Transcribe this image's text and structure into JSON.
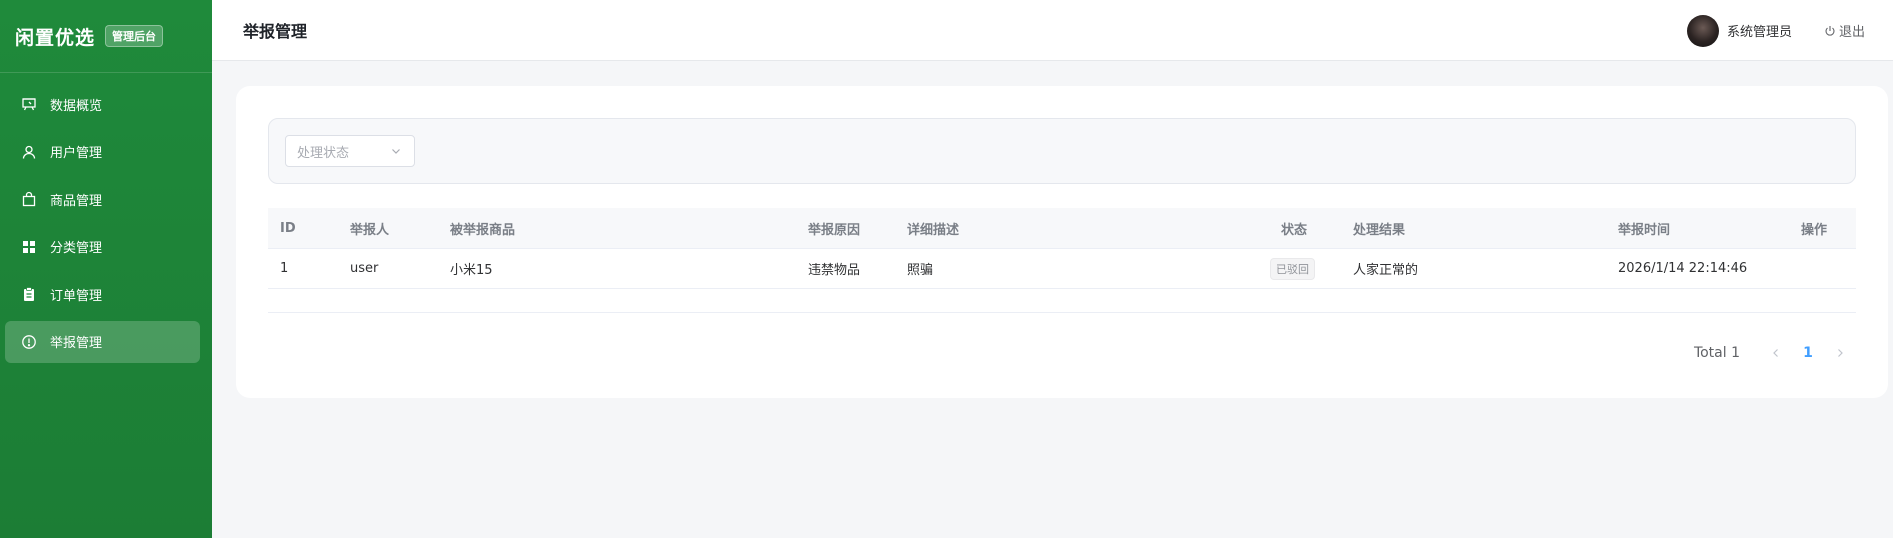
{
  "brand": {
    "title": "闲置优选",
    "badge": "管理后台"
  },
  "sidebar": {
    "items": [
      {
        "label": "数据概览",
        "icon": "dashboard-icon",
        "active": false
      },
      {
        "label": "用户管理",
        "icon": "user-icon",
        "active": false
      },
      {
        "label": "商品管理",
        "icon": "shopping-bag-icon",
        "active": false
      },
      {
        "label": "分类管理",
        "icon": "grid-icon",
        "active": false
      },
      {
        "label": "订单管理",
        "icon": "clipboard-icon",
        "active": false
      },
      {
        "label": "举报管理",
        "icon": "warning-circle-icon",
        "active": true
      }
    ]
  },
  "header": {
    "title": "举报管理",
    "username": "系统管理员",
    "logout_label": "退出"
  },
  "filter": {
    "status_placeholder": "处理状态"
  },
  "table": {
    "columns": [
      "ID",
      "举报人",
      "被举报商品",
      "举报原因",
      "详细描述",
      "状态",
      "处理结果",
      "举报时间",
      "操作"
    ],
    "rows": [
      {
        "id": "1",
        "reporter": "user",
        "product": "小米15",
        "reason": "违禁物品",
        "description": "照骗",
        "status": "已驳回",
        "result": "人家正常的",
        "time": "2026/1/14 22:14:46",
        "actions": ""
      }
    ]
  },
  "pagination": {
    "total_label": "Total 1",
    "current_page": "1"
  },
  "colors": {
    "sidebar": "#1f8a3b",
    "accent": "#409eff",
    "page_bg": "#f5f6f8"
  }
}
